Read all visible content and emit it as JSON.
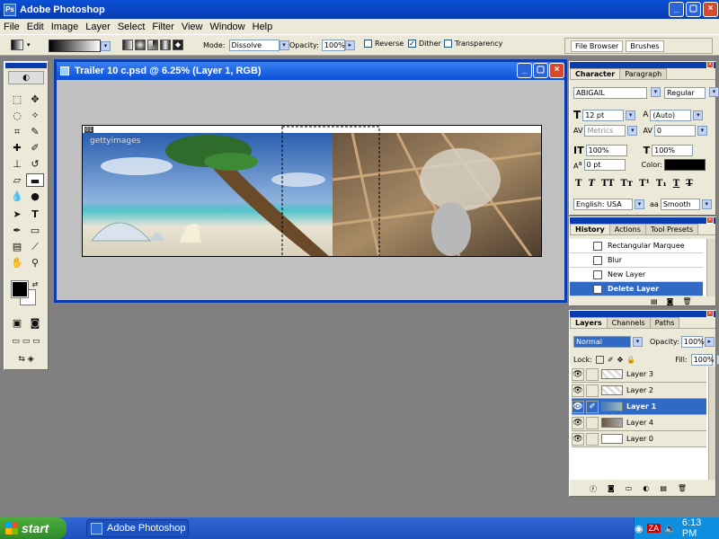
{
  "app": {
    "title": "Adobe Photoshop"
  },
  "menu": [
    "File",
    "Edit",
    "Image",
    "Layer",
    "Select",
    "Filter",
    "View",
    "Window",
    "Help"
  ],
  "options": {
    "mode_label": "Mode:",
    "mode_value": "Dissolve",
    "opacity_label": "Opacity:",
    "opacity_value": "100%",
    "reverse_label": "Reverse",
    "dither_label": "Dither",
    "transparency_label": "Transparency",
    "dither_checked": true
  },
  "palette_well": {
    "file_browser": "File Browser",
    "brushes": "Brushes"
  },
  "document": {
    "title": "Trailer 10 c.psd @ 6.25% (Layer 1, RGB)",
    "canvas_tag": "01",
    "watermark": "gettyimages"
  },
  "character": {
    "tab1": "Character",
    "tab2": "Paragraph",
    "font": "ABIGAIL",
    "style": "Regular",
    "size": "12 pt",
    "leading": "(Auto)",
    "kerning": "Metrics",
    "tracking": "0",
    "vscale": "100%",
    "hscale": "100%",
    "baseline": "0 pt",
    "color_label": "Color:",
    "language": "English: USA",
    "aa_label": "a",
    "antialias": "Smooth"
  },
  "history": {
    "tab1": "History",
    "tab2": "Actions",
    "tab3": "Tool Presets",
    "items": [
      "Rectangular Marquee",
      "Blur",
      "New Layer",
      "Delete Layer"
    ]
  },
  "layers": {
    "tab1": "Layers",
    "tab2": "Channels",
    "tab3": "Paths",
    "blend": "Normal",
    "opacity_label": "Opacity:",
    "opacity": "100%",
    "lock_label": "Lock:",
    "fill_label": "Fill:",
    "fill": "100%",
    "items": [
      "Layer 3",
      "Layer 2",
      "Layer 1",
      "Layer 4",
      "Layer 0"
    ]
  },
  "taskbar": {
    "start": "start",
    "item": "Adobe Photoshop",
    "time": "6:13 PM"
  },
  "colors": {
    "xp_blue": "#0a3cb0",
    "panel_bg": "#ece9d8",
    "selection": "#316ac5"
  }
}
